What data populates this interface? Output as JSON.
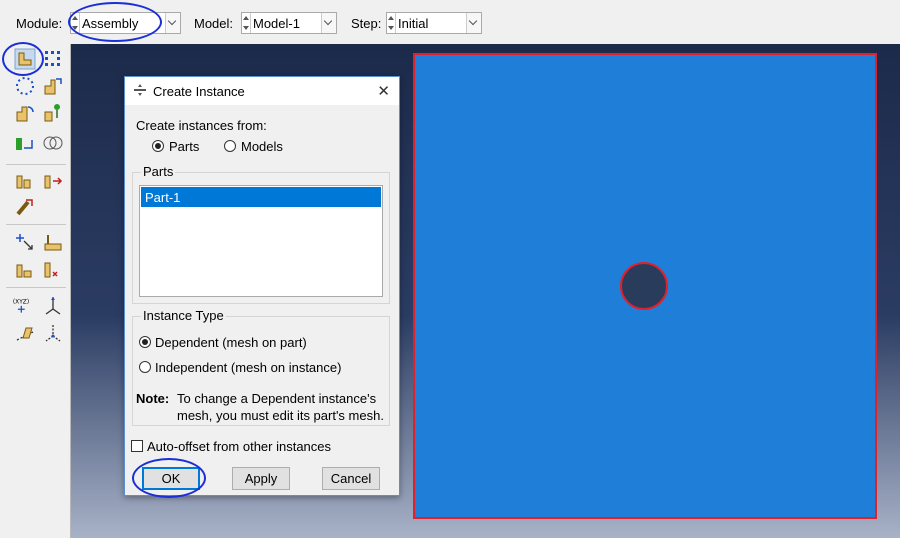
{
  "context_bar": {
    "module_label": "Module:",
    "module_value": "Assembly",
    "model_label": "Model:",
    "model_value": "Model-1",
    "step_label": "Step:",
    "step_value": "Initial"
  },
  "toolbox": {
    "tools": [
      "create-instance-icon",
      "linear-pattern-icon",
      "radial-pattern-icon",
      "translate-instance-icon",
      "rotate-instance-icon",
      "translate-to-icon",
      "merge-cut-icon",
      "boolean-icon",
      "parallel-face-icon",
      "face-to-face-icon",
      "edge-to-edge-icon",
      "coaxial-icon",
      "contact-icon",
      "coincident-point-icon",
      "position-constraint-icon",
      "datum-point-icon",
      "datum-axis-icon",
      "datum-plane-icon",
      "datum-csys-icon",
      "query-icon",
      "partition-icon"
    ]
  },
  "dialog": {
    "title": "Create Instance",
    "close_glyph": "✕",
    "create_from_label": "Create instances from:",
    "opt_parts": "Parts",
    "opt_models": "Models",
    "parts_group": "Parts",
    "parts_list": [
      "Part-1"
    ],
    "instance_type_group": "Instance Type",
    "opt_dependent": "Dependent (mesh on part)",
    "opt_independent": "Independent (mesh on instance)",
    "note_label": "Note:",
    "note_line1": "To change a Dependent instance's",
    "note_line2": "mesh, you must edit its part's mesh.",
    "auto_offset_label": "Auto-offset from other instances",
    "ok_label": "OK",
    "apply_label": "Apply",
    "cancel_label": "Cancel"
  },
  "colors": {
    "part_fill": "#1f7fd8",
    "part_edge": "#e0202a",
    "annotation": "#1a2fd6"
  }
}
